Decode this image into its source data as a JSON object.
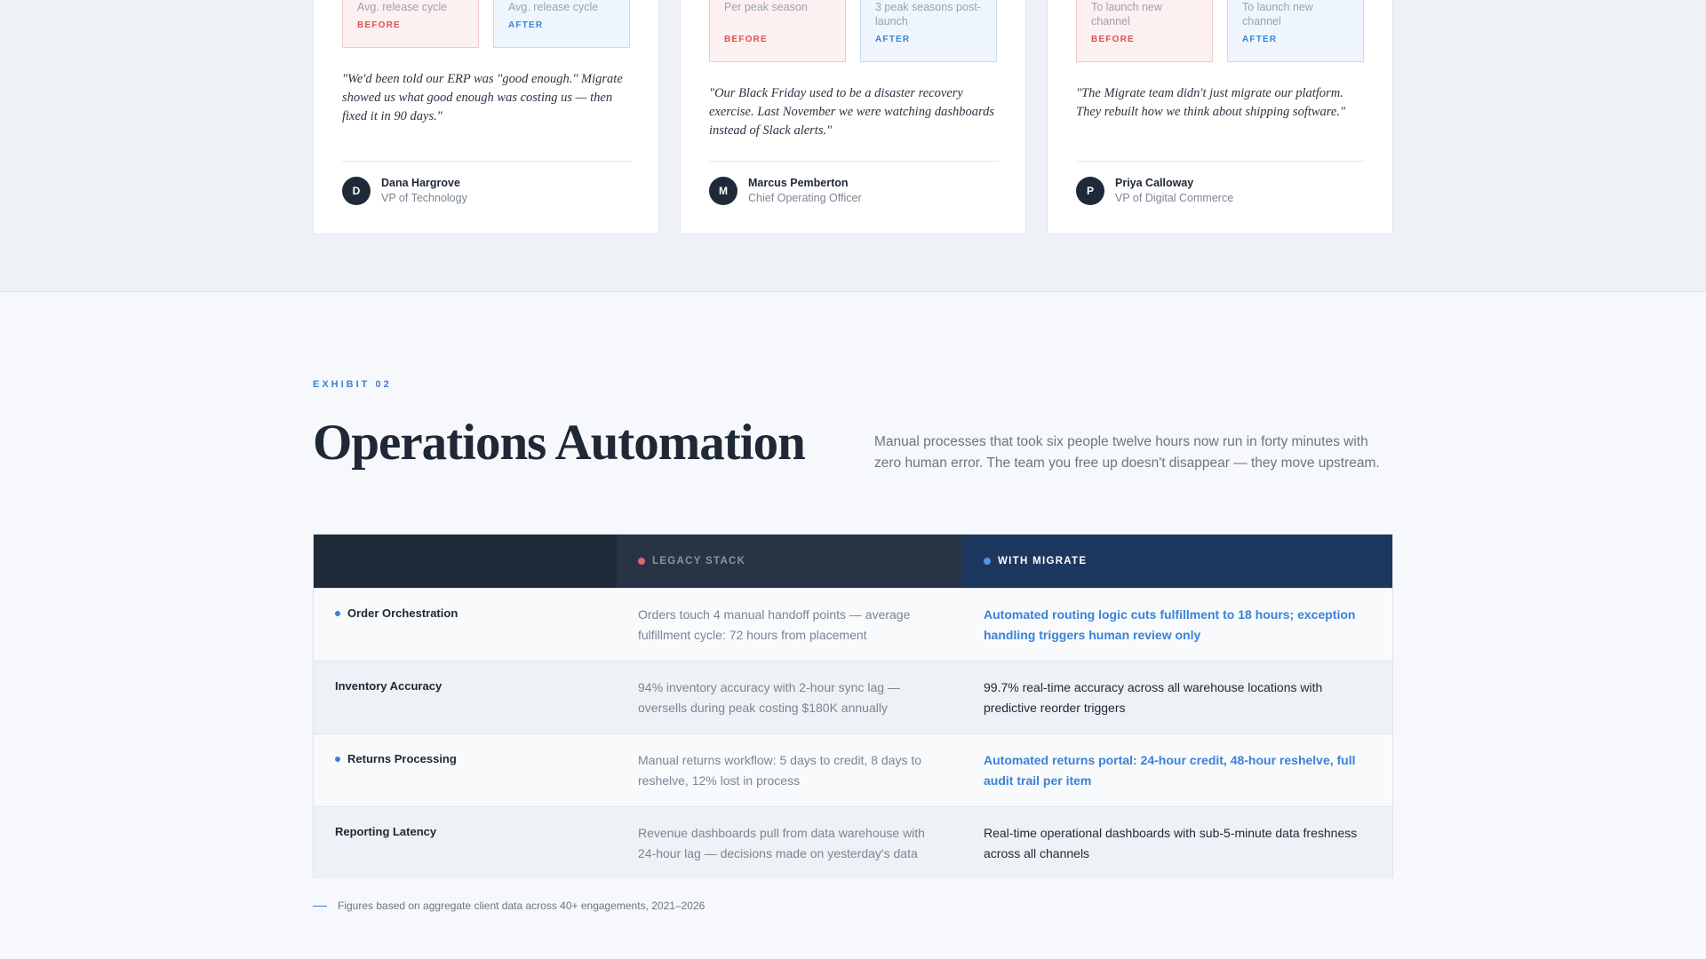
{
  "testimonials": [
    {
      "before_label": "Avg. release cycle",
      "after_label": "Avg. release cycle",
      "before_tag": "BEFORE",
      "after_tag": "AFTER",
      "quote": "\"We'd been told our ERP was \"good enough.\" Migrate showed us what good enough was costing us — then fixed it in 90 days.\"",
      "initial": "D",
      "name": "Dana Hargrove",
      "role": "VP of Technology"
    },
    {
      "before_label": "Per peak season",
      "after_label": "3 peak seasons post-launch",
      "before_tag": "BEFORE",
      "after_tag": "AFTER",
      "quote": "\"Our Black Friday used to be a disaster recovery exercise. Last November we were watching dashboards instead of Slack alerts.\"",
      "initial": "M",
      "name": "Marcus Pemberton",
      "role": "Chief Operating Officer"
    },
    {
      "before_label": "To launch new channel",
      "after_label": "To launch new channel",
      "before_tag": "BEFORE",
      "after_tag": "AFTER",
      "quote": "\"The Migrate team didn't just migrate our platform. They rebuilt how we think about shipping software.\"",
      "initial": "P",
      "name": "Priya Calloway",
      "role": "VP of Digital Commerce"
    }
  ],
  "exhibit": {
    "eyebrow": "EXHIBIT 02",
    "title": "Operations Automation",
    "intro": "Manual processes that took six people twelve hours now run in forty minutes with zero human error. The team you free up doesn't disappear — they move upstream."
  },
  "comparison": {
    "col_legacy": "LEGACY STACK",
    "col_migrate": "WITH MIGRATE",
    "rows": [
      {
        "capability": "Order Orchestration",
        "legacy": "Orders touch 4 manual handoff points — average fulfillment cycle: 72 hours from placement",
        "migrate": "Automated routing logic cuts fulfillment to 18 hours; exception handling triggers human review only"
      },
      {
        "capability": "Inventory Accuracy",
        "legacy": "94% inventory accuracy with 2-hour sync lag — oversells during peak costing $180K annually",
        "migrate": "99.7% real-time accuracy across all warehouse locations with predictive reorder triggers"
      },
      {
        "capability": "Returns Processing",
        "legacy": "Manual returns workflow: 5 days to credit, 8 days to reshelve, 12% lost in process",
        "migrate": "Automated returns portal: 24-hour credit, 48-hour reshelve, full audit trail per item"
      },
      {
        "capability": "Reporting Latency",
        "legacy": "Revenue dashboards pull from data warehouse with 24-hour lag — decisions made on yesterday's data",
        "migrate": "Real-time operational dashboards with sub-5-minute data freshness across all channels"
      }
    ]
  },
  "footnote": "Figures based on aggregate client data across 40+ engagements, 2021–2026",
  "colors": {
    "accent": "#3b82d6",
    "before": "#d9534f",
    "navy": "#1c385f"
  }
}
